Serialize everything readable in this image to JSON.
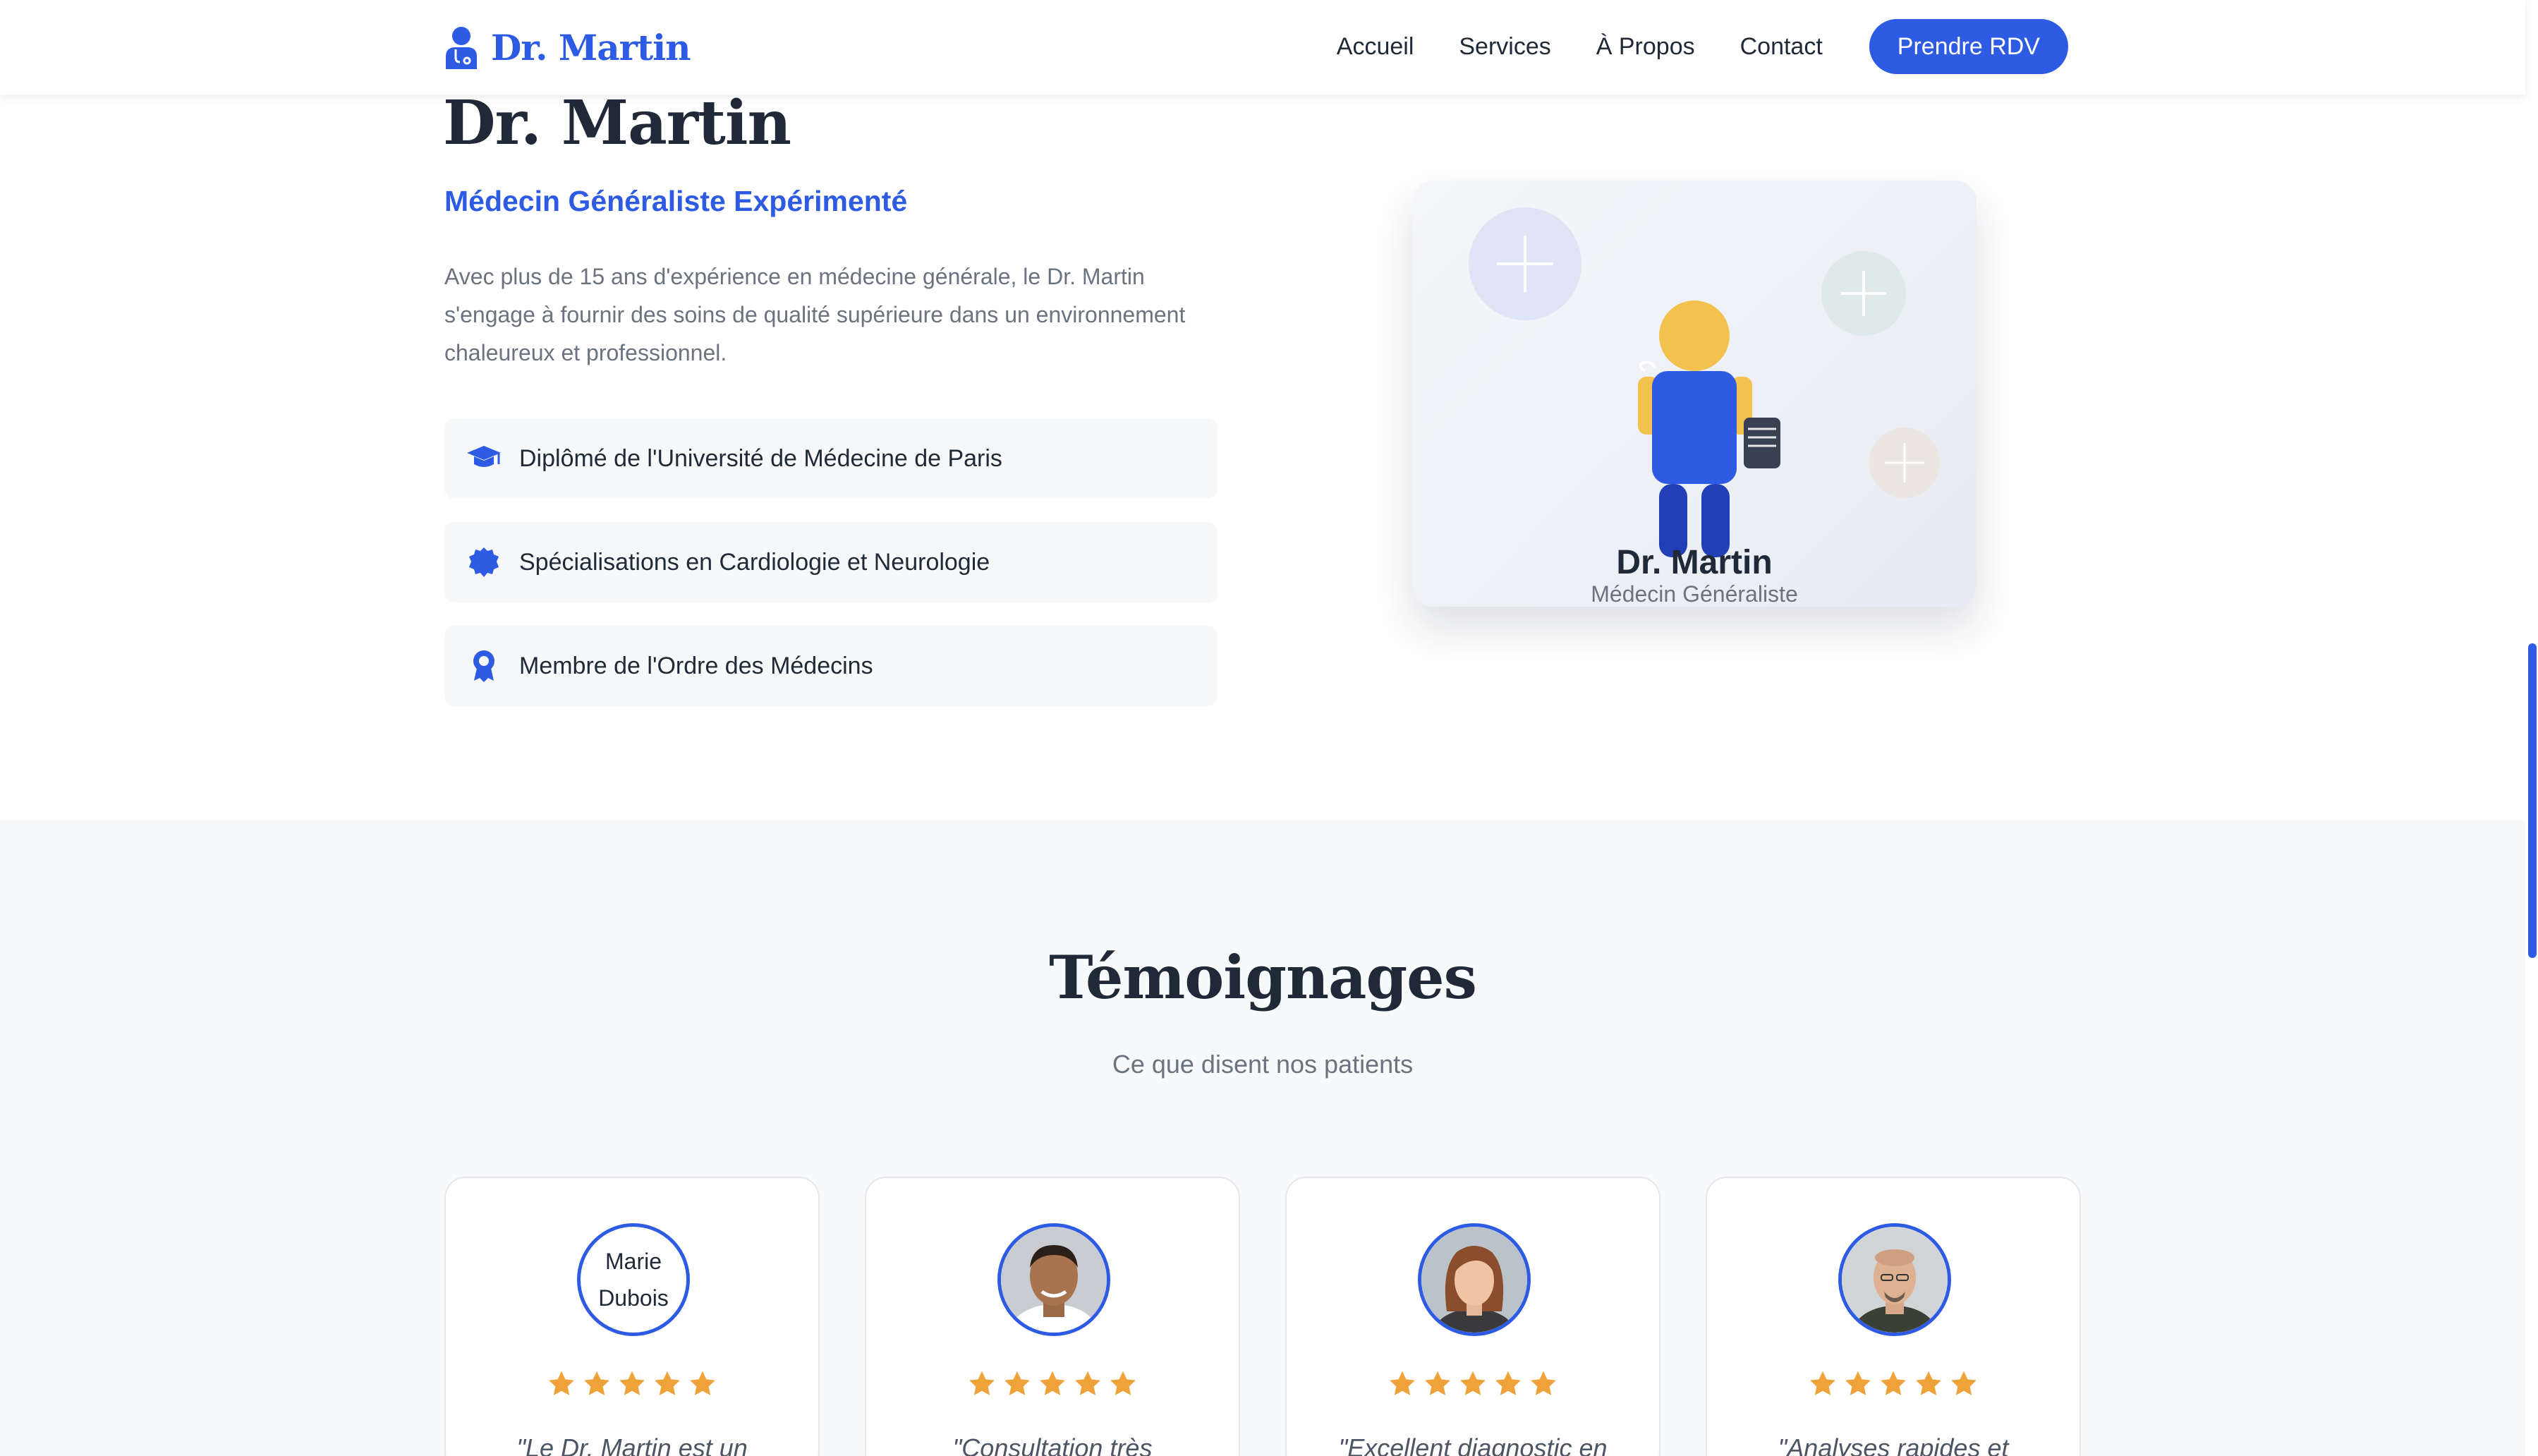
{
  "nav": {
    "brand": "Dr. Martin",
    "links": [
      "Accueil",
      "Services",
      "À Propos",
      "Contact"
    ],
    "cta": "Prendre RDV"
  },
  "hero": {
    "name": "Dr. Martin",
    "subtitle": "Médecin Généraliste Expérimenté",
    "description": "Avec plus de 15 ans d'expérience en médecine générale, le Dr. Martin s'engage à fournir des soins de qualité supérieure dans un environnement chaleureux et professionnel.",
    "credentials": [
      {
        "icon": "graduation-cap-icon",
        "text": "Diplômé de l'Université de Médecine de Paris"
      },
      {
        "icon": "certificate-badge-icon",
        "text": "Spécialisations en Cardiologie et Neurologie"
      },
      {
        "icon": "award-ribbon-icon",
        "text": "Membre de l'Ordre des Médecins"
      }
    ],
    "card": {
      "name": "Dr. Martin",
      "role": "Médecin Généraliste"
    }
  },
  "testimonials": {
    "title": "Témoignages",
    "subtitle": "Ce que disent nos patients",
    "items": [
      {
        "avatar_alt": "Marie Dubois",
        "rating": 5,
        "quote": "\"Le Dr. Martin est un"
      },
      {
        "avatar_alt": "",
        "rating": 5,
        "quote": "\"Consultation très"
      },
      {
        "avatar_alt": "",
        "rating": 5,
        "quote": "\"Excellent diagnostic en"
      },
      {
        "avatar_alt": "",
        "rating": 5,
        "quote": "\"Analyses rapides et"
      }
    ]
  },
  "colors": {
    "primary": "#2d5be3",
    "star": "#f0a23a",
    "text": "#1f2937",
    "muted": "#6b7280",
    "section_bg": "#f8f9fb"
  }
}
